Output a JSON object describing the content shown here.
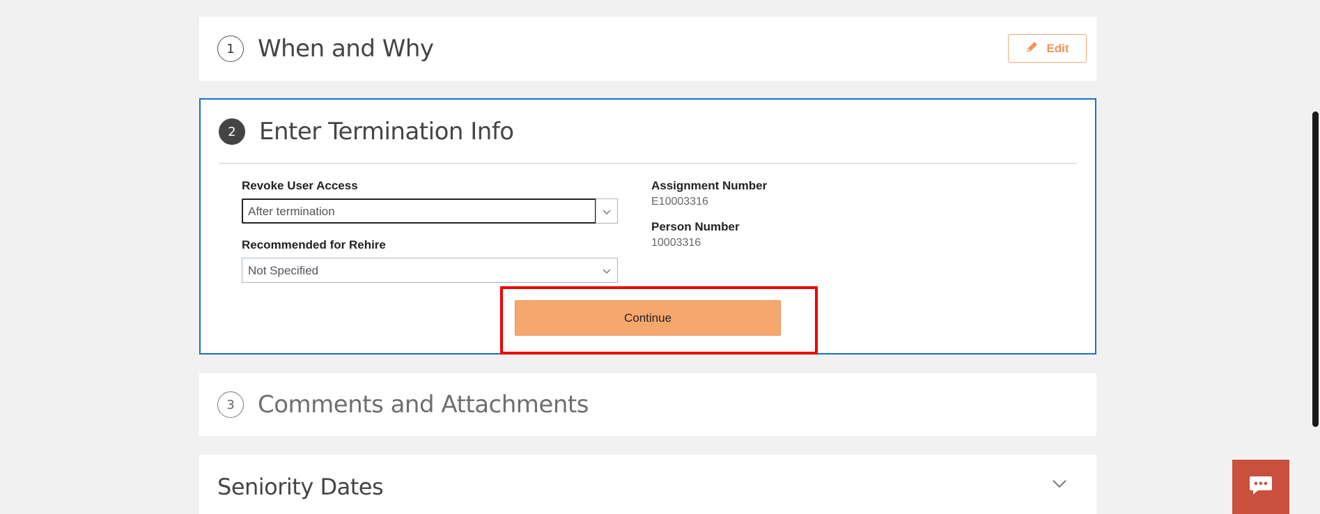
{
  "steps": [
    {
      "number": "1",
      "title": "When and Why",
      "edit_label": "Edit"
    },
    {
      "number": "2",
      "title": "Enter Termination Info"
    },
    {
      "number": "3",
      "title": "Comments and Attachments"
    }
  ],
  "termination_info": {
    "revoke_access": {
      "label": "Revoke User Access",
      "value": "After termination"
    },
    "rehire": {
      "label": "Recommended for Rehire",
      "value": "Not Specified"
    },
    "assignment_number": {
      "label": "Assignment Number",
      "value": "E10003316"
    },
    "person_number": {
      "label": "Person Number",
      "value": "10003316"
    },
    "continue_label": "Continue"
  },
  "seniority": {
    "title": "Seniority Dates"
  },
  "colors": {
    "accent_orange": "#f5a76d",
    "active_border": "#1a6fc4",
    "highlight": "#ee0000",
    "chat_button": "#c8503c"
  },
  "icons": {
    "edit": "pencil-icon",
    "dropdown": "chevron-down-icon",
    "expand": "chevron-down-icon",
    "chat": "chat-bubble-icon"
  }
}
